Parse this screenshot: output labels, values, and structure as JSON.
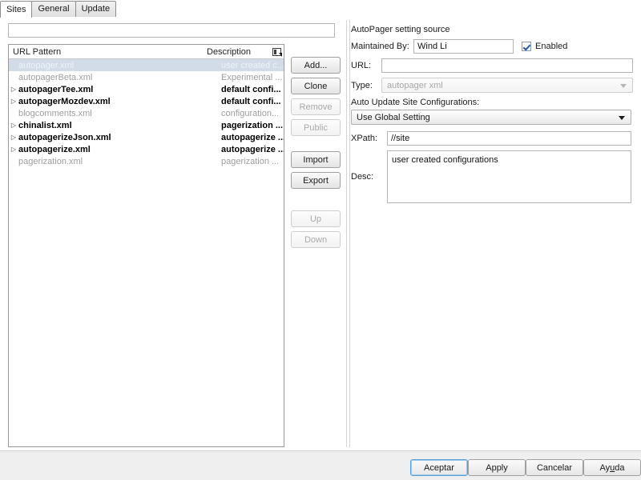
{
  "tabs": [
    {
      "label": "Sites",
      "active": true
    },
    {
      "label": "General",
      "active": false
    },
    {
      "label": "Update",
      "active": false
    }
  ],
  "left": {
    "filter": {
      "value": "",
      "placeholder": ""
    },
    "columns": {
      "url_pattern": "URL Pattern",
      "description": "Description"
    },
    "column_chooser_icon": "column-chooser-icon",
    "rows": [
      {
        "name": "autopager.xml",
        "desc": "user created c...",
        "expandable": false,
        "state": "selected"
      },
      {
        "name": "autopagerBeta.xml",
        "desc": "Experimental ...",
        "expandable": false,
        "state": "dim"
      },
      {
        "name": "autopagerTee.xml",
        "desc": "default confi...",
        "expandable": true,
        "state": "bold"
      },
      {
        "name": "autopagerMozdev.xml",
        "desc": "default confi...",
        "expandable": true,
        "state": "bold"
      },
      {
        "name": "blogcomments.xml",
        "desc": "configuration...",
        "expandable": false,
        "state": "dim"
      },
      {
        "name": "chinalist.xml",
        "desc": "pagerization ...",
        "expandable": true,
        "state": "bold"
      },
      {
        "name": "autopagerizeJson.xml",
        "desc": "autopagerize ...",
        "expandable": true,
        "state": "bold"
      },
      {
        "name": "autopagerize.xml",
        "desc": "autopagerize ...",
        "expandable": true,
        "state": "bold"
      },
      {
        "name": "pagerization.xml",
        "desc": "pagerization ...",
        "expandable": false,
        "state": "dim"
      }
    ],
    "buttons": [
      {
        "label": "Add...",
        "enabled": true
      },
      {
        "label": "Clone",
        "enabled": true
      },
      {
        "label": "Remove",
        "enabled": false
      },
      {
        "label": "Public",
        "enabled": false
      },
      {
        "label": "Import",
        "enabled": true
      },
      {
        "label": "Export",
        "enabled": true
      },
      {
        "label": "Up",
        "enabled": false
      },
      {
        "label": "Down",
        "enabled": false
      }
    ]
  },
  "right": {
    "group_title": "AutoPager setting source",
    "maintained_by": {
      "label": "Maintained By:",
      "value": "Wind Li"
    },
    "enabled": {
      "label": "Enabled",
      "checked": true
    },
    "url": {
      "label": "URL:",
      "value": ""
    },
    "type": {
      "label": "Type:",
      "value": "autopager xml",
      "enabled": false
    },
    "auto_update": {
      "label": "Auto Update Site Configurations:",
      "value": "Use Global Setting"
    },
    "xpath": {
      "label": "XPath:",
      "value": "//site"
    },
    "desc": {
      "label": "Desc:",
      "value": "user created configurations"
    }
  },
  "footer": {
    "accept": "Aceptar",
    "apply": "Apply",
    "cancel": "Cancelar",
    "help_before": "Ay",
    "help_mnemonic": "u",
    "help_after": "da"
  }
}
